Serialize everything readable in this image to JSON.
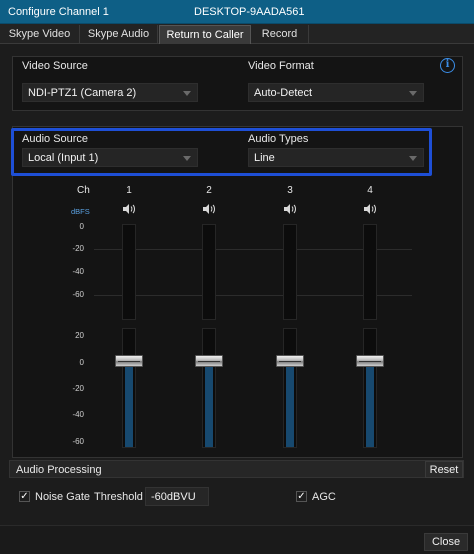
{
  "window": {
    "title": "Configure Channel 1",
    "machine": "DESKTOP-9AADA561"
  },
  "tabs": [
    {
      "label": "Skype Video",
      "active": false
    },
    {
      "label": "Skype Audio",
      "active": false
    },
    {
      "label": "Return to Caller",
      "active": true
    },
    {
      "label": "Record",
      "active": false
    }
  ],
  "video": {
    "source_label": "Video Source",
    "source_value": "NDI-PTZ1 (Camera 2)",
    "format_label": "Video Format",
    "format_value": "Auto-Detect",
    "info_icon": "i"
  },
  "audio": {
    "source_label": "Audio Source",
    "source_value": "Local (Input 1)",
    "types_label": "Audio Types",
    "types_value": "Line"
  },
  "mixer": {
    "ch_label": "Ch",
    "dbfs_label": "dBFS",
    "channels": [
      {
        "label": "1",
        "level": 0
      },
      {
        "label": "2",
        "level": 0
      },
      {
        "label": "3",
        "level": 0
      },
      {
        "label": "4",
        "level": 0
      }
    ],
    "scale": [
      "0",
      "-20",
      "-40",
      "-60",
      "20",
      "0",
      "-20",
      "-40",
      "-60"
    ]
  },
  "processing": {
    "title": "Audio Processing",
    "reset_label": "Reset",
    "noise_gate_label": "Noise Gate",
    "noise_gate_checked": true,
    "threshold_label": "Threshold",
    "threshold_value": "-60dBVU",
    "agc_label": "AGC",
    "agc_checked": true,
    "check_mark": "✓"
  },
  "footer": {
    "close_label": "Close"
  },
  "colors": {
    "titlebar": "#0e5f86",
    "highlight": "#1e4fd6",
    "info": "#3b8ee8",
    "meter_fill": "#17496f"
  }
}
